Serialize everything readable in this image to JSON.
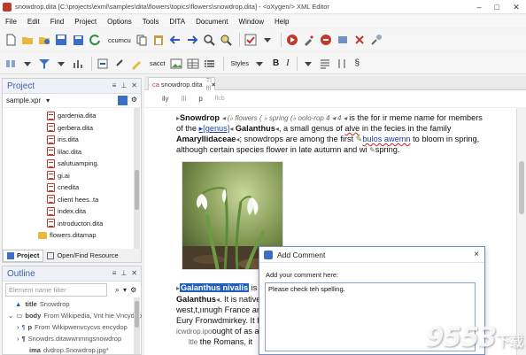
{
  "window": {
    "title": "snowdrop.dita [C:\\projects\\exml\\samples\\dita\\flowers\\topics\\flowers\\snowdrop.dita] - <oXygen/> XML Editor"
  },
  "menu": [
    "File",
    "Edit",
    "Find",
    "Project",
    "Options",
    "Tools",
    "DITA",
    "Document",
    "Window",
    "Help"
  ],
  "toolbar": {
    "fragment_1": "ccumcu",
    "fragment_2": "sacct",
    "styles_label": "Styles",
    "bold_label": "B",
    "italic_label": "I",
    "section_label": "§"
  },
  "project_panel": {
    "title": "Project",
    "project_file": "sample.xpr",
    "files": [
      "gardenia.dita",
      "gerbera.dita",
      "iris.dita",
      "lilac.dita",
      "salutuamping.",
      "gi.ai",
      "cnedita",
      "client hees..ta",
      "index.dita",
      "introducton.dita"
    ],
    "ditamap": "flowers.ditamap"
  },
  "panel_tabs": {
    "project": "Project",
    "open_find": "Open/Find Resource"
  },
  "outline": {
    "title": "Outline",
    "filter_placeholder": "Element name filter",
    "rows": [
      {
        "tag": "title",
        "text": "Snowdrop"
      },
      {
        "tag": "body",
        "text": "From Wikipedia, Vnt hie Vncydop"
      },
      {
        "tag": "p",
        "text": "From Wikipwenvcycvs encydop"
      },
      {
        "tag": "¶",
        "text": "Snowdrs.ditawwnmngsnowdrop"
      },
      {
        "tag": "ima",
        "text": "dvdrop.Snowdrop.jpg*"
      }
    ]
  },
  "editor": {
    "tab_label": "snowdrop.dita",
    "tab_prefix": "ca",
    "tab_fragment": "Tl ffl",
    "tab_close": "×",
    "breadcrumb": [
      "ily",
      "p"
    ],
    "breadcrumb_marker": "Ill",
    "breadcrumb_fragment": "flcb",
    "para1": {
      "tag_open": "▸",
      "title": "Snowdrop",
      "tag1": "◂ (♭ flowers ( ♭ spring (♭ oolo-rop 4 ◂ 4 ◂",
      "text1": "is the for ir meme name for members",
      "text2": "of the",
      "genus_tag": "▸[genus]",
      "genus": "genus",
      "text3": "Galanthus",
      "text4": ", a small genus of",
      "squiggle1": "alve",
      "text5": "in the fecies in the family",
      "family": "Amaryllidaceae",
      "text6": "; snowdrops are among the first",
      "squiggle2": "bulos awemn",
      "text7": "to bloom in spring,",
      "text8": "although certain species flower in late autumn and wi",
      "text9": "spring."
    },
    "para2": {
      "highlight": "Galanthus nivalis",
      "text1": "is",
      "line2a": "Galanthus",
      "line2b": ". It is native",
      "line3": "west,",
      "line3b": "t,ıınugh France ar",
      "line4": "Eury Fronwdm",
      "line4b": "irkey. It has",
      "line5": "icwdrop.ipo",
      "line5b": "ought of as a",
      "line6": "ltle",
      "line6b": "the Romans, it"
    }
  },
  "dialog": {
    "title": "Add Comment",
    "close": "×",
    "label": "Add your comment here:",
    "comment": "Please check teh spelling."
  },
  "colors": {
    "accent": "#3a5ea8",
    "highlight": "#1f5fbf",
    "dita_icon": "#c0392b"
  },
  "watermark": {
    "number": "9553",
    "sub": "下载"
  }
}
